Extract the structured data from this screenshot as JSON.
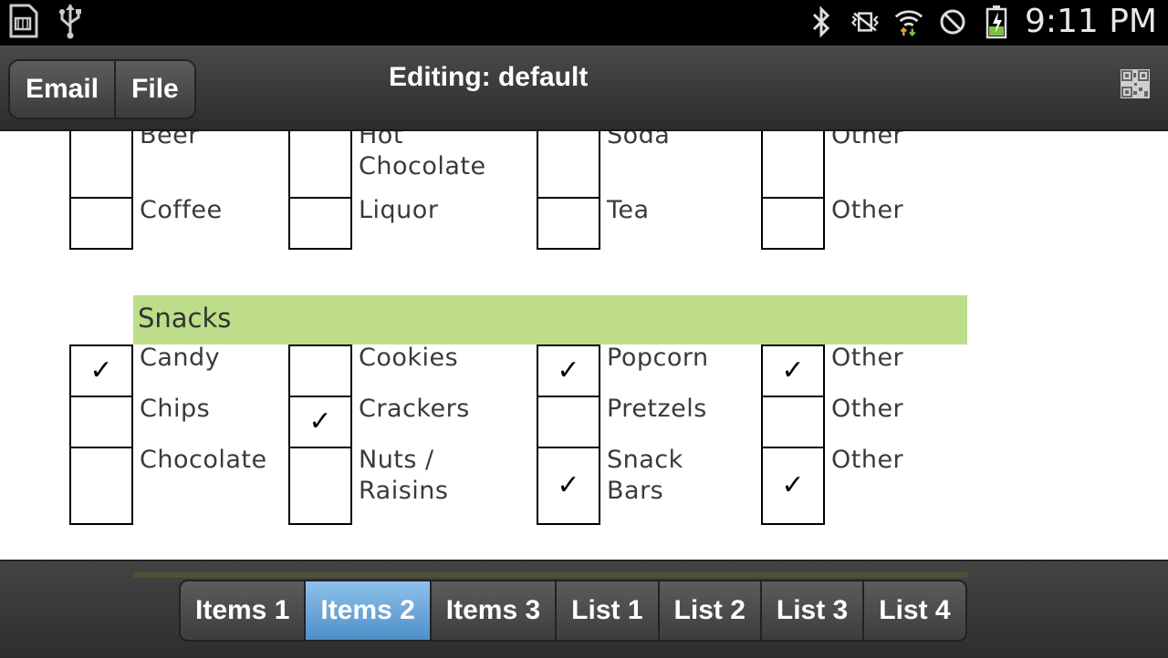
{
  "status_bar": {
    "time": "9:11 PM",
    "left_icons": [
      "sd-card-icon",
      "usb-icon"
    ],
    "right_icons": [
      "bluetooth-icon",
      "vibrate-icon",
      "wifi-icon",
      "blocked-icon",
      "battery-charging-icon"
    ]
  },
  "toolbar": {
    "email_label": "Email",
    "file_label": "File",
    "title": "Editing: default",
    "qr_icon": "qr-code-icon"
  },
  "drinks": {
    "columns": [
      [
        {
          "label": "Beer",
          "checked": false
        },
        {
          "label": "Coffee",
          "checked": false
        }
      ],
      [
        {
          "label": "Hot Chocolate",
          "checked": false
        },
        {
          "label": "Liquor",
          "checked": false
        }
      ],
      [
        {
          "label": "Soda",
          "checked": false
        },
        {
          "label": "Tea",
          "checked": false
        }
      ],
      [
        {
          "label": "Other",
          "checked": false
        },
        {
          "label": "Other",
          "checked": false
        }
      ]
    ]
  },
  "snacks": {
    "title": "Snacks",
    "columns": [
      [
        {
          "label": "Candy",
          "checked": true
        },
        {
          "label": "Chips",
          "checked": false
        },
        {
          "label": "Chocolate",
          "checked": false
        }
      ],
      [
        {
          "label": "Cookies",
          "checked": false
        },
        {
          "label": "Crackers",
          "checked": true
        },
        {
          "label": "Nuts / Raisins",
          "checked": false
        }
      ],
      [
        {
          "label": "Popcorn",
          "checked": true
        },
        {
          "label": "Pretzels",
          "checked": false
        },
        {
          "label": "Snack Bars",
          "checked": true
        }
      ],
      [
        {
          "label": "Other",
          "checked": true
        },
        {
          "label": "Other",
          "checked": false
        },
        {
          "label": "Other",
          "checked": true
        }
      ]
    ]
  },
  "check_mark": "✓",
  "tabs": {
    "items": [
      {
        "label": "Items 1",
        "active": false
      },
      {
        "label": "Items 2",
        "active": true
      },
      {
        "label": "Items 3",
        "active": false
      },
      {
        "label": "List 1",
        "active": false
      },
      {
        "label": "List 2",
        "active": false
      },
      {
        "label": "List 3",
        "active": false
      },
      {
        "label": "List 4",
        "active": false
      }
    ]
  },
  "colors": {
    "section_header_bg": "#bddd8a",
    "active_tab": "#6aa8dc",
    "bar_bg": "#3a3a3a"
  }
}
